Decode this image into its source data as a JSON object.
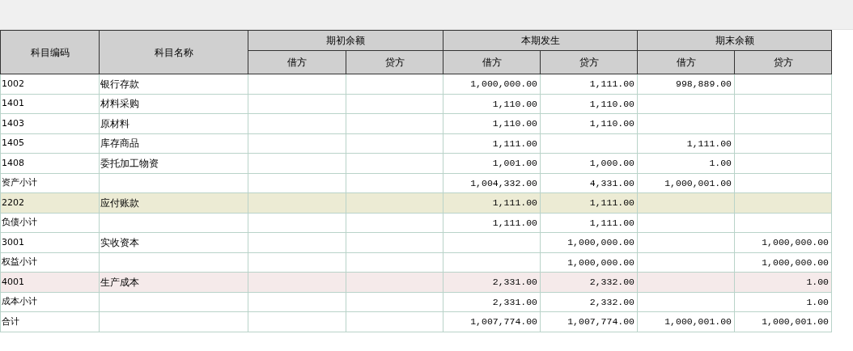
{
  "table": {
    "columns": [
      {
        "label": "科目编码"
      },
      {
        "label": "科目名称"
      }
    ],
    "groups": [
      {
        "label": "期初余额",
        "sub": [
          "借方",
          "贷方"
        ]
      },
      {
        "label": "本期发生",
        "sub": [
          "借方",
          "贷方"
        ]
      },
      {
        "label": "期末余额",
        "sub": [
          "借方",
          "贷方"
        ]
      }
    ],
    "rows": [
      {
        "code": "1002",
        "name": "银行存款",
        "color": "#ffffff",
        "amounts": {
          "period_debit": "1,000,000.00",
          "period_credit": "1,111.00",
          "closing_debit": "998,889.00"
        }
      },
      {
        "code": "1401",
        "name": "材料采购",
        "color": "#ffffff",
        "amounts": {
          "period_debit": "1,110.00",
          "period_credit": "1,110.00"
        }
      },
      {
        "code": "1403",
        "name": "原材料",
        "color": "#ffffff",
        "amounts": {
          "period_debit": "1,110.00",
          "period_credit": "1,110.00"
        }
      },
      {
        "code": "1405",
        "name": "库存商品",
        "color": "#ffffff",
        "amounts": {
          "period_debit": "1,111.00",
          "closing_debit": "1,111.00"
        }
      },
      {
        "code": "1408",
        "name": "委托加工物资",
        "color": "#ffffff",
        "amounts": {
          "period_debit": "1,001.00",
          "period_credit": "1,000.00",
          "closing_debit": "1.00"
        }
      },
      {
        "code": "资产小计",
        "color": "#ffffff",
        "amounts": {
          "period_debit": "1,004,332.00",
          "period_credit": "4,331.00",
          "closing_debit": "1,000,001.00"
        }
      },
      {
        "code": "2202",
        "name": "应付账款",
        "color": "#ecebd4",
        "amounts": {
          "period_debit": "1,111.00",
          "period_credit": "1,111.00"
        }
      },
      {
        "code": "负债小计",
        "color": "#ffffff",
        "amounts": {
          "period_debit": "1,111.00",
          "period_credit": "1,111.00"
        }
      },
      {
        "code": "3001",
        "name": "实收资本",
        "color": "#ffffff",
        "amounts": {
          "period_credit": "1,000,000.00",
          "closing_credit": "1,000,000.00"
        }
      },
      {
        "code": "权益小计",
        "color": "#ffffff",
        "amounts": {
          "period_credit": "1,000,000.00",
          "closing_credit": "1,000,000.00"
        }
      },
      {
        "code": "4001",
        "name": "生产成本",
        "color": "#f5eaea",
        "amounts": {
          "period_debit": "2,331.00",
          "period_credit": "2,332.00",
          "closing_credit": "1.00"
        }
      },
      {
        "code": "成本小计",
        "color": "#ffffff",
        "amounts": {
          "period_debit": "2,331.00",
          "period_credit": "2,332.00",
          "closing_credit": "1.00"
        }
      },
      {
        "code": "合计",
        "color": "#ffffff",
        "amounts": {
          "period_debit": "1,007,774.00",
          "period_credit": "1,007,774.00",
          "closing_debit": "1,000,001.00",
          "closing_credit": "1,000,001.00"
        }
      }
    ]
  }
}
